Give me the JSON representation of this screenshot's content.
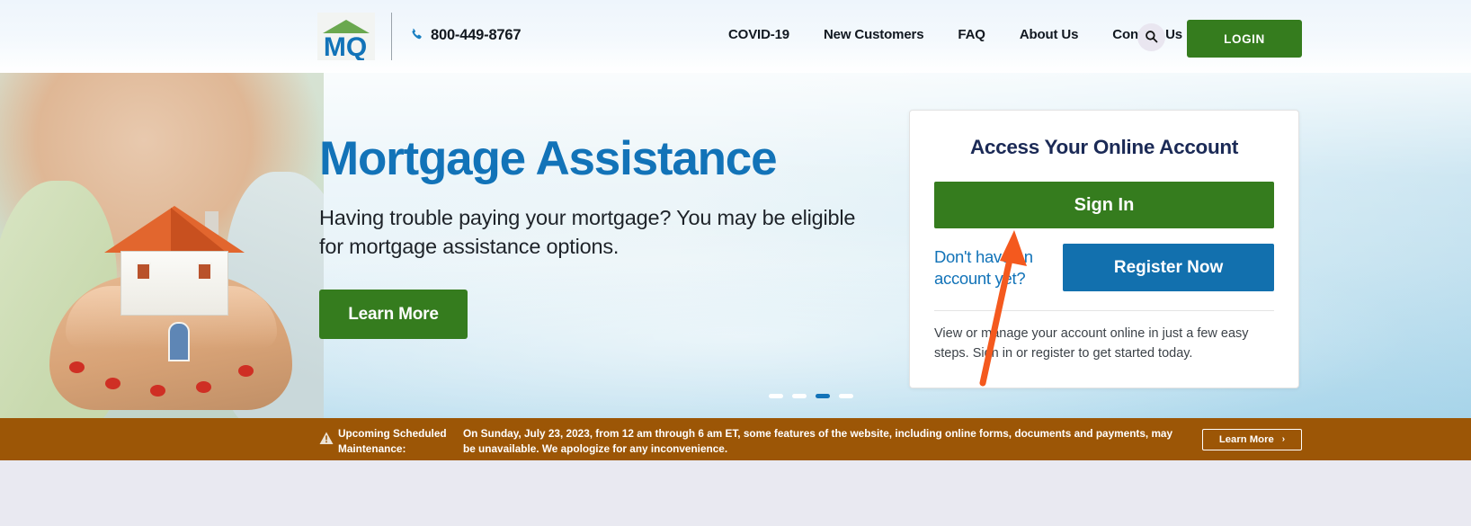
{
  "header": {
    "logo_alt": "MQ",
    "phone_icon": "phone-icon",
    "phone": "800-449-8767",
    "nav": [
      {
        "label": "COVID-19"
      },
      {
        "label": "New Customers"
      },
      {
        "label": "FAQ"
      },
      {
        "label": "About Us"
      },
      {
        "label": "Contact Us"
      }
    ],
    "search_icon": "search-icon",
    "login_label": "LOGIN"
  },
  "hero": {
    "title": "Mortgage Assistance",
    "subtitle": "Having trouble paying your mortgage? You may be eligible for mortgage assistance options.",
    "cta_label": "Learn More",
    "carousel": {
      "total": 4,
      "active_index": 3
    }
  },
  "account_card": {
    "title": "Access Your Online Account",
    "signin_label": "Sign In",
    "no_account_text": "Don't have an account yet?",
    "register_label": "Register Now",
    "note": "View or manage your account online in just a few easy steps. Sign in or register to get started today."
  },
  "maintenance_banner": {
    "warning_icon": "warning-triangle-icon",
    "label": "Upcoming Scheduled Maintenance:",
    "message": "On Sunday, July 23, 2023, from 12 am through 6 am ET, some features of the website, including online forms, documents and payments, may be unavailable. We apologize for any inconvenience.",
    "learn_more_label": "Learn More",
    "chevron_icon": "chevron-right-icon"
  },
  "annotation": {
    "type": "arrow",
    "color": "#f4591e",
    "points_to": "sign-in-button"
  },
  "colors": {
    "brand_blue": "#1273b8",
    "brand_green": "#357c1e",
    "register_blue": "#1270ae",
    "navy": "#1b2a56",
    "banner_brown": "#9c5606",
    "annotation_orange": "#f4591e"
  }
}
